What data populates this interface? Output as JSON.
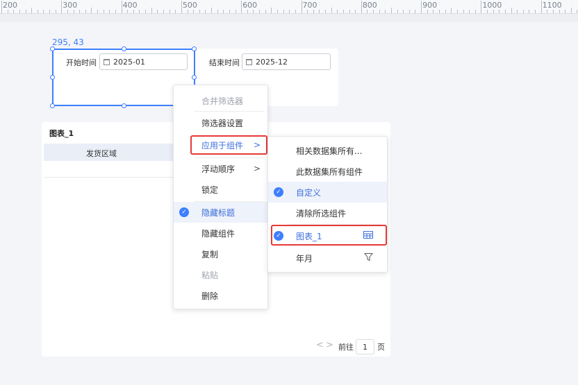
{
  "ruler": {
    "labels": [
      "200",
      "300",
      "400",
      "500",
      "600",
      "700",
      "800",
      "900",
      "1000",
      "1100"
    ]
  },
  "selection": {
    "coords": "295, 43"
  },
  "filters": {
    "start_label": "开始时间",
    "start_value": "2025-01",
    "end_label": "结束时间",
    "end_value": "2025-12"
  },
  "table": {
    "title": "图表_1",
    "column_header": "发货区域"
  },
  "pager": {
    "prev": "<",
    "next": ">",
    "goto_label": "前往",
    "page": "1",
    "page_suffix": "页"
  },
  "context_menu": {
    "items": [
      {
        "label": "合并筛选器",
        "disabled": true
      },
      {
        "label": "筛选器设置"
      },
      {
        "label": "应用于组件",
        "submenu": true,
        "highlighted": true
      },
      {
        "label": "浮动顺序",
        "submenu": true
      },
      {
        "label": "锁定"
      },
      {
        "label": "隐藏标题",
        "checked": true,
        "selected": true
      },
      {
        "label": "隐藏组件"
      },
      {
        "label": "复制"
      },
      {
        "label": "粘贴",
        "disabled": true
      },
      {
        "label": "删除"
      }
    ],
    "chevron": ">"
  },
  "submenu": {
    "items": [
      {
        "label": "相关数据集所有..."
      },
      {
        "label": "此数据集所有组件"
      },
      {
        "label": "自定义",
        "checked": true,
        "selected": true
      },
      {
        "label": "清除所选组件"
      },
      {
        "label": "图表_1",
        "checked": true,
        "icon": "table-icon",
        "highlighted": true
      },
      {
        "label": "年月",
        "icon": "filter-icon"
      }
    ]
  },
  "colors": {
    "accent": "#3d7fff",
    "highlight_border": "#e53935",
    "selected_bg": "#eef2fa"
  }
}
